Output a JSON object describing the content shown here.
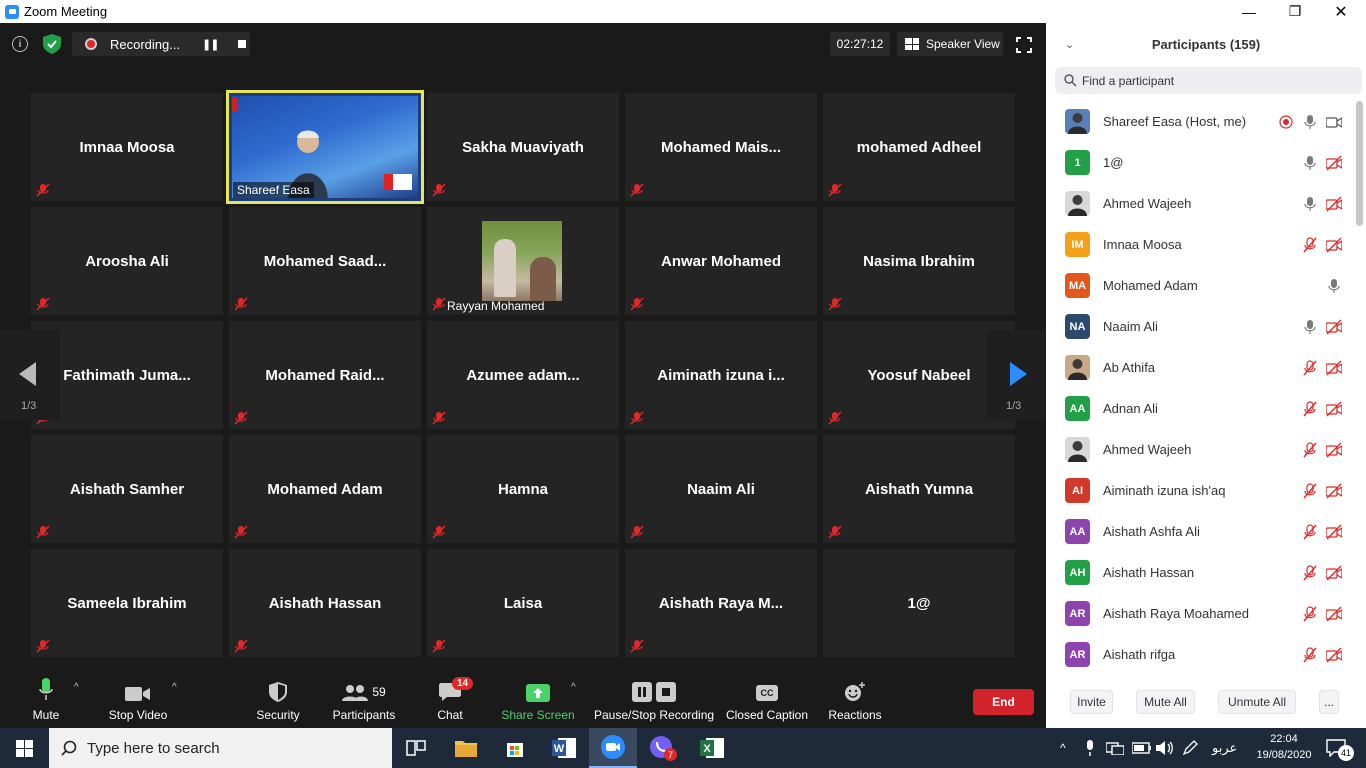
{
  "window": {
    "title": "Zoom Meeting",
    "controls": {
      "minimize": "—",
      "restore": "❐",
      "close": "✕"
    }
  },
  "topbar": {
    "info_glyph": "i",
    "recording_label": "Recording...",
    "pause_glyph": "❚❚",
    "timer": "02:27:12",
    "view_label": "Speaker View",
    "colors": {
      "shield": "#23a047",
      "record": "#e02828"
    }
  },
  "gallery": {
    "tiles": [
      {
        "name": "Imnaa Moosa"
      },
      {
        "name": "Shareef Easa",
        "video": true
      },
      {
        "name": "Sakha Muaviyath"
      },
      {
        "name": "Mohamed  Mais..."
      },
      {
        "name": "mohamed Adheel"
      },
      {
        "name": "Aroosha Ali"
      },
      {
        "name": "Mohamed  Saad..."
      },
      {
        "name": "Rayyan Mohamed",
        "photo": true
      },
      {
        "name": "Anwar Mohamed"
      },
      {
        "name": "Nasima Ibrahim"
      },
      {
        "name": "Fathimath  Juma..."
      },
      {
        "name": "Mohamed  Raid..."
      },
      {
        "name": "Azumee  adam..."
      },
      {
        "name": "Aiminath  izuna  i..."
      },
      {
        "name": "Yoosuf Nabeel"
      },
      {
        "name": "Aishath Samher"
      },
      {
        "name": "Mohamed Adam"
      },
      {
        "name": "Hamna"
      },
      {
        "name": "Naaim Ali"
      },
      {
        "name": "Aishath Yumna"
      },
      {
        "name": "Sameela Ibrahim"
      },
      {
        "name": "Aishath Hassan"
      },
      {
        "name": "Laisa"
      },
      {
        "name": "Aishath Raya M..."
      },
      {
        "name": "1@"
      }
    ],
    "page_prev": "1/3",
    "page_next": "1/3",
    "active_outline_color": "#e6e65c"
  },
  "toolbar": {
    "mute": "Mute",
    "stop_video": "Stop Video",
    "security": "Security",
    "participants": "Participants",
    "participants_count": "59",
    "chat": "Chat",
    "chat_badge": "14",
    "share_screen": "Share Screen",
    "pause_stop_recording": "Pause/Stop Recording",
    "closed_caption": "Closed Caption",
    "cc_glyph": "CC",
    "reactions": "Reactions",
    "end": "End",
    "caret": "^",
    "colors": {
      "share": "#4ad26b",
      "end": "#d3232a"
    }
  },
  "participants_panel": {
    "title": "Participants (159)",
    "search_placeholder": "Find a participant",
    "items": [
      {
        "initials": "",
        "name": "Shareef Easa (Host, me)",
        "color": "#5a7fb5",
        "mic": "on",
        "video": "on",
        "recording": true
      },
      {
        "initials": "1",
        "name": "1@",
        "color": "#23a047",
        "mic": "on",
        "video": "off"
      },
      {
        "initials": "",
        "name": "Ahmed Wajeeh",
        "color": "#d8d8d8",
        "mic": "on",
        "video": "off"
      },
      {
        "initials": "IM",
        "name": "Imnaa Moosa",
        "color": "#f5a01a",
        "mic": "off",
        "video": "off"
      },
      {
        "initials": "MA",
        "name": "Mohamed Adam",
        "color": "#e4571b",
        "mic": "on",
        "video": "none"
      },
      {
        "initials": "NA",
        "name": "Naaim Ali",
        "color": "#2c4a6e",
        "mic": "on",
        "video": "off"
      },
      {
        "initials": "",
        "name": "Ab Athifa",
        "color": "#c9a888",
        "mic": "off",
        "video": "off"
      },
      {
        "initials": "AA",
        "name": "Adnan Ali",
        "color": "#23a047",
        "mic": "off",
        "video": "off"
      },
      {
        "initials": "",
        "name": "Ahmed Wajeeh",
        "color": "#d8d8d8",
        "mic": "off",
        "video": "off"
      },
      {
        "initials": "AI",
        "name": "Aiminath izuna ish'aq",
        "color": "#d03a2a",
        "mic": "off",
        "video": "off"
      },
      {
        "initials": "AA",
        "name": "Aishath Ashfa Ali",
        "color": "#8e44ad",
        "mic": "off",
        "video": "off"
      },
      {
        "initials": "AH",
        "name": "Aishath Hassan",
        "color": "#23a047",
        "mic": "off",
        "video": "off"
      },
      {
        "initials": "AR",
        "name": "Aishath Raya Moahamed",
        "color": "#8e44ad",
        "mic": "off",
        "video": "off"
      },
      {
        "initials": "AR",
        "name": "Aishath rifga",
        "color": "#8e44ad",
        "mic": "off",
        "video": "off"
      }
    ],
    "footer": {
      "invite": "Invite",
      "mute_all": "Mute All",
      "unmute_all": "Unmute All",
      "more": "..."
    },
    "colors": {
      "muted_red": "#e02828"
    }
  },
  "taskbar": {
    "search_placeholder": "Type here to search",
    "viber_badge": "7",
    "tray_lang": "عربو",
    "clock_time": "22:04",
    "clock_date": "19/08/2020",
    "notif_count": "41",
    "tray_caret": "^"
  }
}
